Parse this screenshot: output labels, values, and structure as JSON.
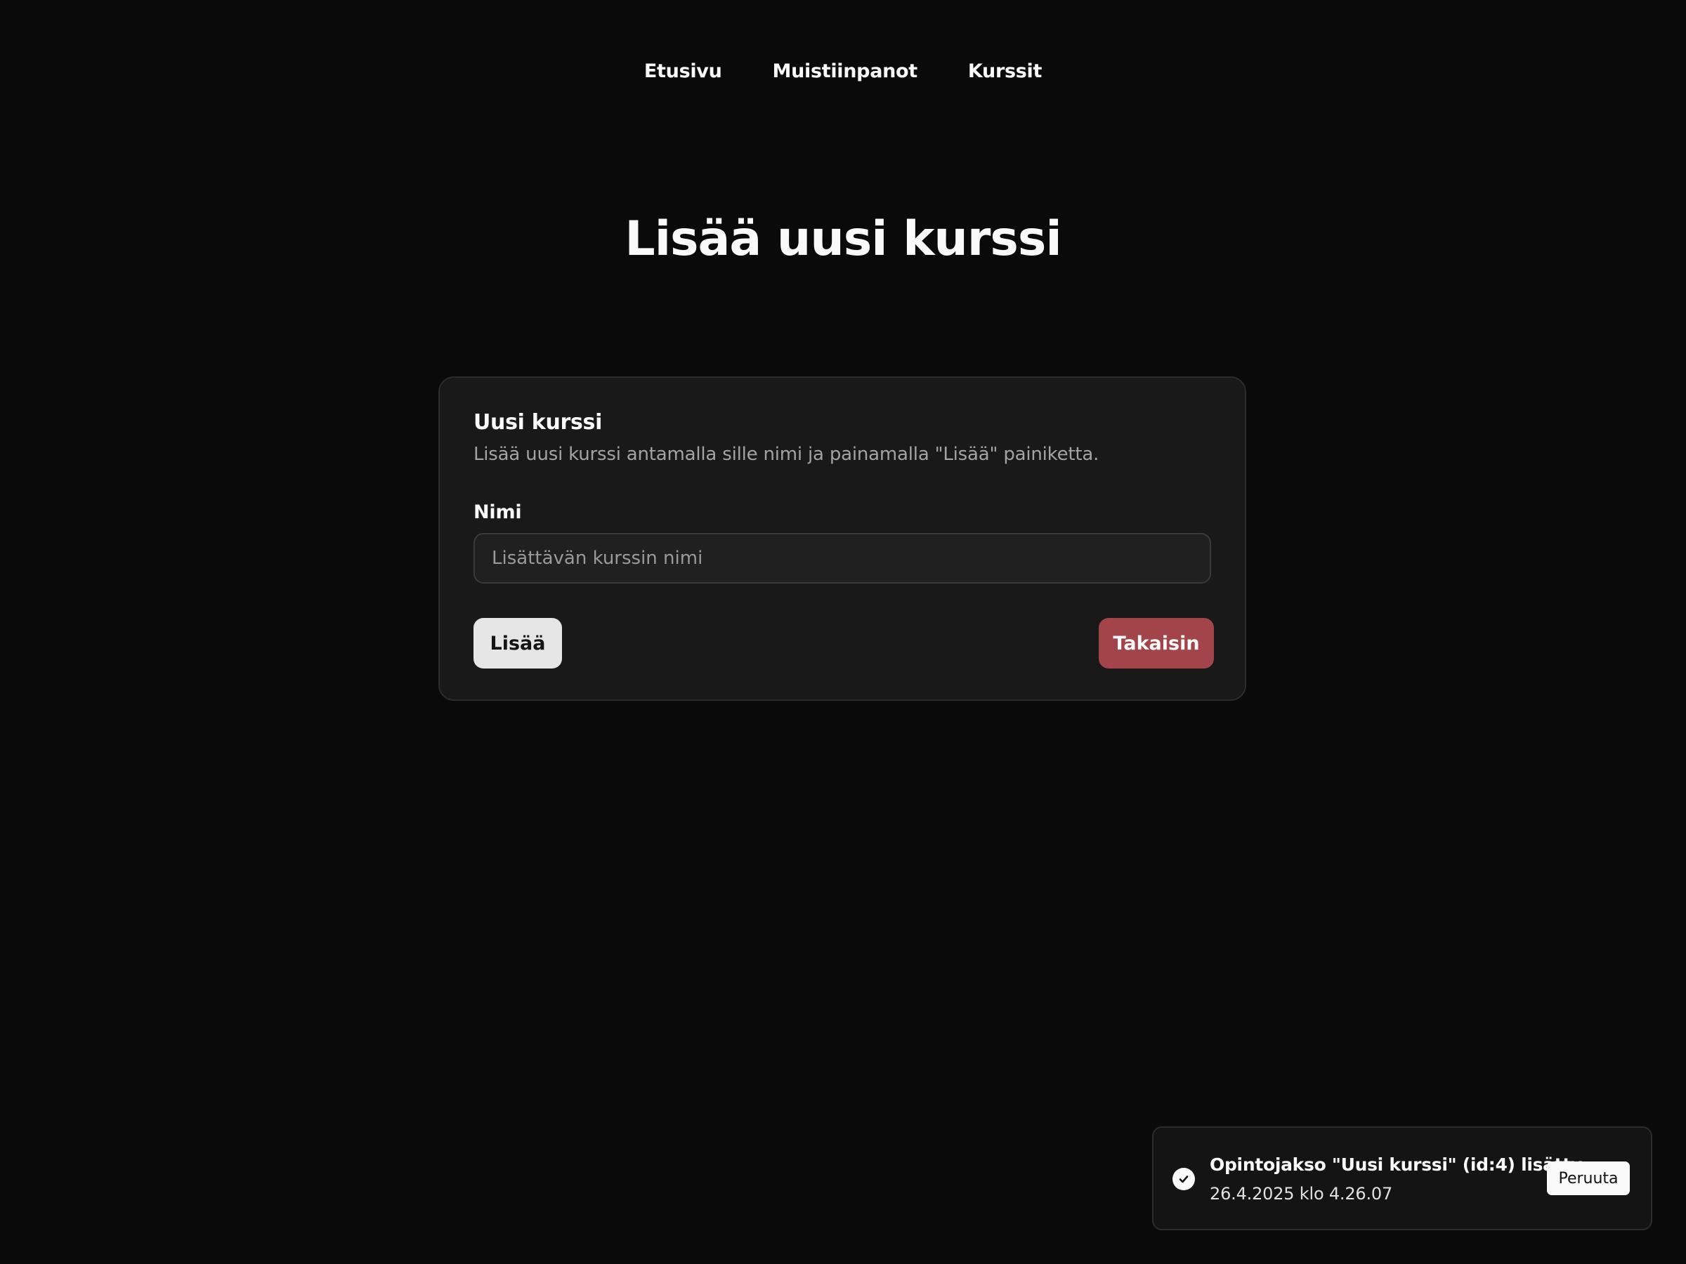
{
  "nav": {
    "items": [
      {
        "label": "Etusivu"
      },
      {
        "label": "Muistiinpanot"
      },
      {
        "label": "Kurssit"
      }
    ]
  },
  "page": {
    "title": "Lisää uusi kurssi"
  },
  "card": {
    "title": "Uusi kurssi",
    "description": "Lisää uusi kurssi antamalla sille nimi ja painamalla \"Lisää\" painiketta.",
    "name_label": "Nimi",
    "name_value": "",
    "name_placeholder": "Lisättävän kurssin nimi",
    "add_label": "Lisää",
    "back_label": "Takaisin"
  },
  "toast": {
    "icon": "check-circle-icon",
    "title": "Opintojakso \"Uusi kurssi\" (id:4) lisätty",
    "time": "26.4.2025 klo 4.26.07",
    "undo_label": "Peruuta"
  },
  "colors": {
    "background": "#0a0a0a",
    "card": "#191919",
    "primary_button": "#e6e6e6",
    "destructive_button": "#a2444a",
    "muted_text": "#a3a3a3"
  }
}
